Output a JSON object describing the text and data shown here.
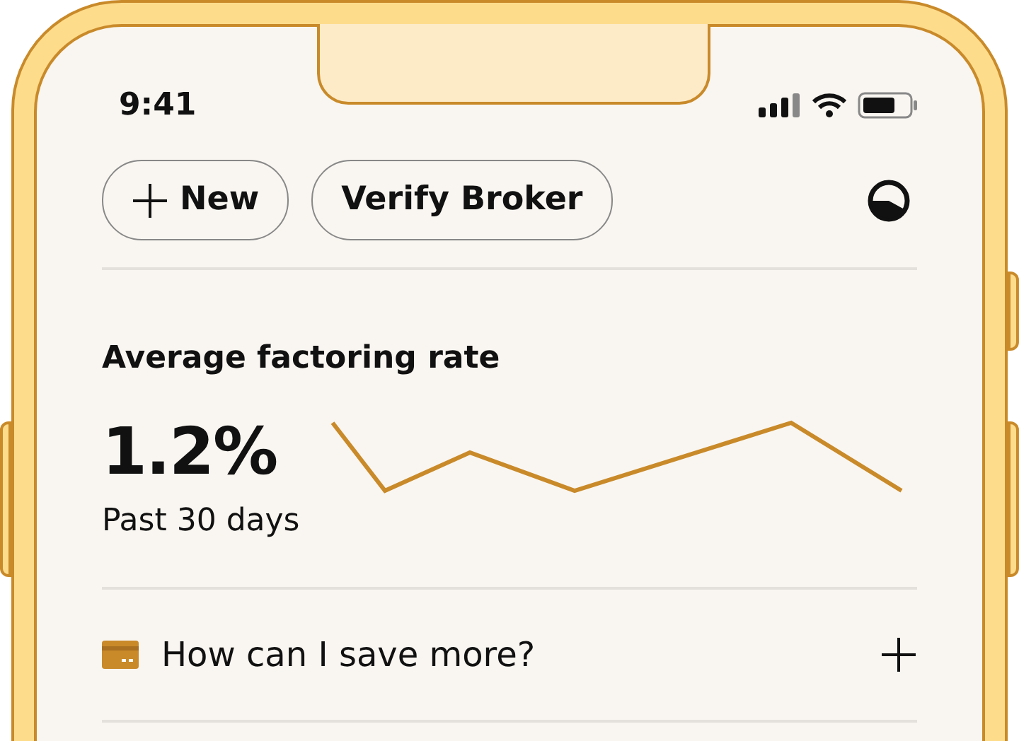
{
  "status_bar": {
    "time": "9:41"
  },
  "actions": [
    {
      "label": "New",
      "kind": "add"
    },
    {
      "label": "Verify Broker",
      "kind": "plain"
    }
  ],
  "rate_card": {
    "title": "Average factoring rate",
    "value": "1.2%",
    "period": "Past 30 days"
  },
  "faq": [
    {
      "question": "How can I save more?",
      "expanded": false
    }
  ]
}
